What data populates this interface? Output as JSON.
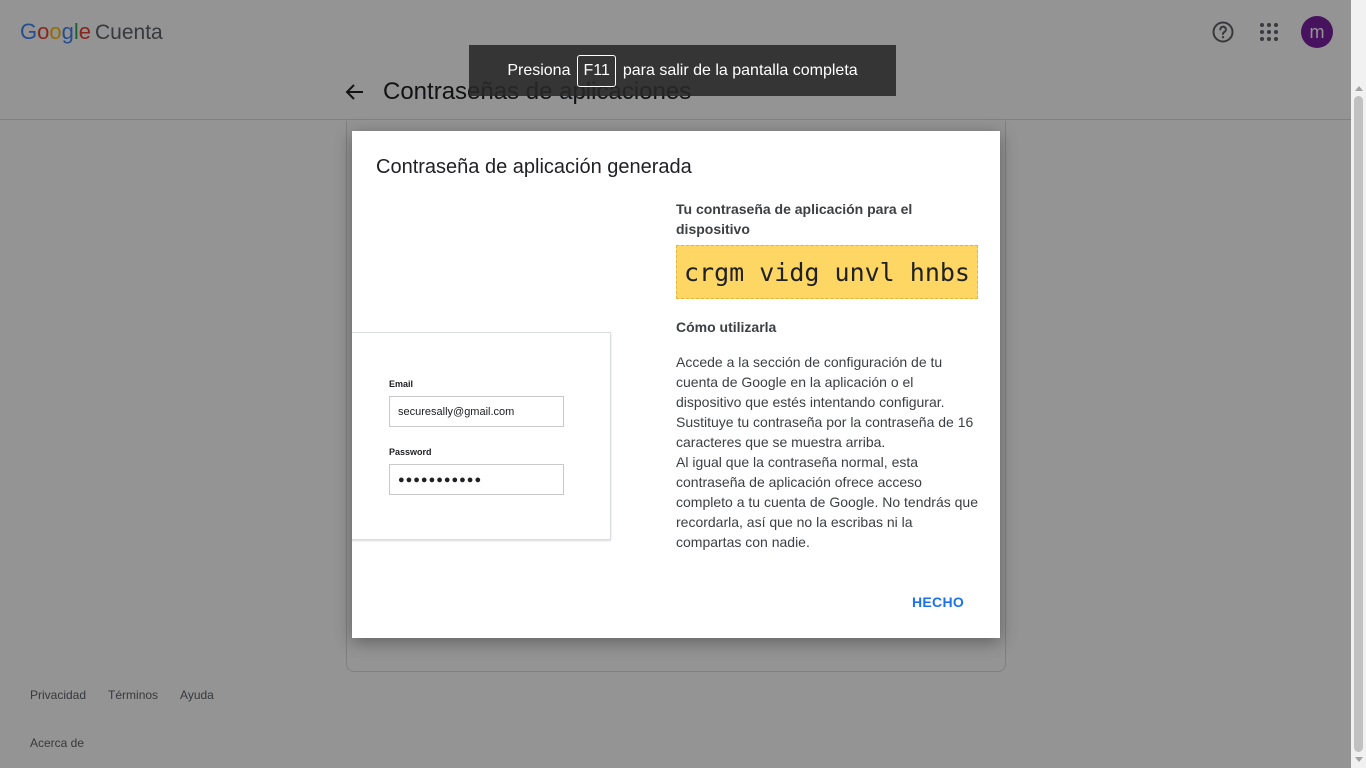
{
  "header": {
    "logo_letters": [
      "G",
      "o",
      "o",
      "g",
      "l",
      "e"
    ],
    "logo_colors": [
      "#4285f4",
      "#ea4335",
      "#fbbc05",
      "#4285f4",
      "#34a853",
      "#ea4335"
    ],
    "product_name": "Cuenta",
    "avatar_initial": "m",
    "avatar_color": "#7b1fa2",
    "page_title": "Contraseñas de aplicaciones",
    "icons": [
      "help-icon",
      "apps-grid-icon",
      "back-arrow-icon"
    ]
  },
  "fullscreen_toast": {
    "prefix": "Presiona",
    "key": "F11",
    "suffix": "para salir de la pantalla completa"
  },
  "dialog": {
    "title": "Contraseña de aplicación generada",
    "password_heading": "Tu contraseña de aplicación para el dispositivo",
    "generated_password": "crgm vidg unvl hnbs",
    "how_heading": "Cómo utilizarla",
    "how_paragraph_1": "Accede a la sección de configuración de tu cuenta de Google en la aplicación o el dispositivo que estés intentando configurar. Sustituye tu contraseña por la contraseña de 16 caracteres que se muestra arriba.",
    "how_paragraph_2": "Al igual que la contraseña normal, esta contraseña de aplicación ofrece acceso completo a tu cuenta de Google. No tendrás que recordarla, así que no la escribas ni la compartas con nadie.",
    "done_label": "HECHO",
    "illustration": {
      "email_label": "Email",
      "email_value": "securesally@gmail.com",
      "password_label": "Password",
      "password_value": "●●●●●●●●●●●"
    }
  },
  "footer": {
    "links": [
      "Privacidad",
      "Términos",
      "Ayuda"
    ],
    "about": "Acerca de"
  }
}
